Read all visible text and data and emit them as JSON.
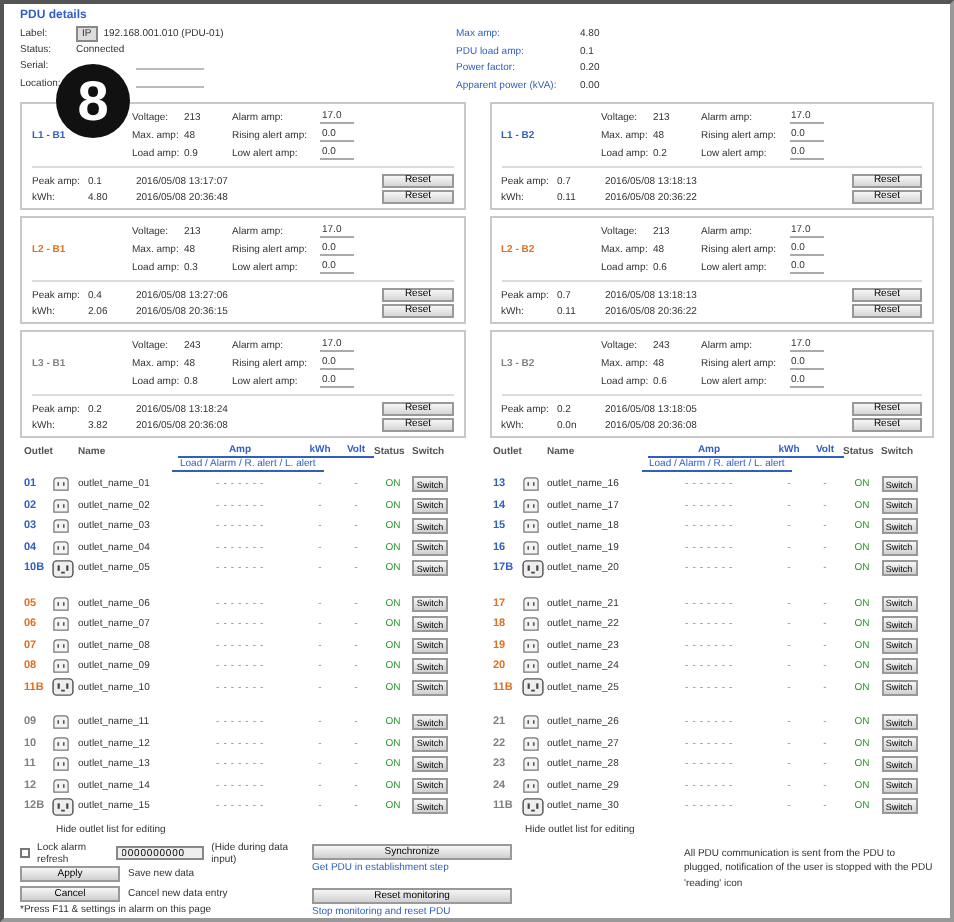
{
  "badge": "8",
  "title": "PDU details",
  "info_left": [
    {
      "label": "Label:",
      "tag": "IP",
      "value": "192.168.001.010 (PDU-01)"
    },
    {
      "label": "Status:",
      "value": "Connected"
    },
    {
      "label": "Serial:"
    },
    {
      "label": "Location:"
    }
  ],
  "info_right": [
    {
      "label": "Max amp:",
      "value": "4.80"
    },
    {
      "label": "PDU load amp:",
      "value": "0.1"
    },
    {
      "label": "Power factor:",
      "value": "0.20"
    },
    {
      "label": "Apparent power (kVA):",
      "value": "0.00"
    }
  ],
  "columns": [
    {
      "phases": [
        {
          "name": "L1 - B1",
          "color": "#2f5fc4",
          "readings": [
            {
              "label": "Voltage:",
              "value": "213"
            },
            {
              "label": "Max. amp:",
              "value": "48"
            },
            {
              "label": "Load amp:",
              "value": "0.9"
            }
          ],
          "alerts": [
            {
              "label": "Alarm amp:",
              "value": "17.0"
            },
            {
              "label": "Rising alert amp:",
              "value": "0.0"
            },
            {
              "label": "Low alert amp:",
              "value": "0.0"
            }
          ],
          "history": [
            {
              "label": "Peak amp:",
              "value": "0.1",
              "time": "2016/05/08 13:17:07",
              "button": "Reset"
            },
            {
              "label": "kWh:",
              "value": "4.80",
              "time": "2016/05/08 20:36:48",
              "button": "Reset"
            }
          ]
        },
        {
          "name": "L2 - B1",
          "color": "#e07020",
          "readings": [
            {
              "label": "Voltage:",
              "value": "213"
            },
            {
              "label": "Max. amp:",
              "value": "48"
            },
            {
              "label": "Load amp:",
              "value": "0.3"
            }
          ],
          "alerts": [
            {
              "label": "Alarm amp:",
              "value": "17.0"
            },
            {
              "label": "Rising alert amp:",
              "value": "0.0"
            },
            {
              "label": "Low alert amp:",
              "value": "0.0"
            }
          ],
          "history": [
            {
              "label": "Peak amp:",
              "value": "0.4",
              "time": "2016/05/08 13:27:06",
              "button": "Reset"
            },
            {
              "label": "kWh:",
              "value": "2.06",
              "time": "2016/05/08 20:36:15",
              "button": "Reset"
            }
          ]
        },
        {
          "name": "L3 - B1",
          "color": "#808080",
          "readings": [
            {
              "label": "Voltage:",
              "value": "243"
            },
            {
              "label": "Max. amp:",
              "value": "48"
            },
            {
              "label": "Load amp:",
              "value": "0.8"
            }
          ],
          "alerts": [
            {
              "label": "Alarm amp:",
              "value": "17.0"
            },
            {
              "label": "Rising alert amp:",
              "value": "0.0"
            },
            {
              "label": "Low alert amp:",
              "value": "0.0"
            }
          ],
          "history": [
            {
              "label": "Peak amp:",
              "value": "0.2",
              "time": "2016/05/08 13:18:24",
              "button": "Reset"
            },
            {
              "label": "kWh:",
              "value": "3.82",
              "time": "2016/05/08 20:36:08",
              "button": "Reset"
            }
          ]
        }
      ],
      "table": {
        "headers": [
          "Outlet",
          "Name",
          "Amp",
          "kWh",
          "Volt",
          "Status",
          "Switch"
        ],
        "subheader": "Load / Alarm / R. alert / L. alert",
        "groups": [
          {
            "color": "#2f5fc4",
            "rows": [
              {
                "number": "01",
                "kind": "socket",
                "name": "outlet_name_01",
                "readings": "- - - - - - -",
                "kwh": "-",
                "volt": "-",
                "status": "ON",
                "button": "Switch"
              },
              {
                "number": "02",
                "kind": "socket",
                "name": "outlet_name_02",
                "readings": "- - - - - - -",
                "kwh": "-",
                "volt": "-",
                "status": "ON",
                "button": "Switch"
              },
              {
                "number": "03",
                "kind": "socket",
                "name": "outlet_name_03",
                "readings": "- - - - - - -",
                "kwh": "-",
                "volt": "-",
                "status": "ON",
                "button": "Switch"
              },
              {
                "number": "04",
                "kind": "socket",
                "name": "outlet_name_04",
                "readings": "- - - - - - -",
                "kwh": "-",
                "volt": "-",
                "status": "ON",
                "button": "Switch"
              },
              {
                "number": "10B",
                "kind": "c19",
                "name": "outlet_name_05",
                "readings": "- - - - - - -",
                "kwh": "-",
                "volt": "-",
                "status": "ON",
                "button": "Switch"
              }
            ]
          },
          {
            "color": "#e07020",
            "rows": [
              {
                "number": "05",
                "kind": "socket",
                "name": "outlet_name_06",
                "readings": "- - - - - - -",
                "kwh": "-",
                "volt": "-",
                "status": "ON",
                "button": "Switch"
              },
              {
                "number": "06",
                "kind": "socket",
                "name": "outlet_name_07",
                "readings": "- - - - - - -",
                "kwh": "-",
                "volt": "-",
                "status": "ON",
                "button": "Switch"
              },
              {
                "number": "07",
                "kind": "socket",
                "name": "outlet_name_08",
                "readings": "- - - - - - -",
                "kwh": "-",
                "volt": "-",
                "status": "ON",
                "button": "Switch"
              },
              {
                "number": "08",
                "kind": "socket",
                "name": "outlet_name_09",
                "readings": "- - - - - - -",
                "kwh": "-",
                "volt": "-",
                "status": "ON",
                "button": "Switch"
              },
              {
                "number": "11B",
                "kind": "c19",
                "name": "outlet_name_10",
                "readings": "- - - - - - -",
                "kwh": "-",
                "volt": "-",
                "status": "ON",
                "button": "Switch"
              }
            ]
          },
          {
            "color": "#808080",
            "rows": [
              {
                "number": "09",
                "kind": "socket",
                "name": "outlet_name_11",
                "readings": "- - - - - - -",
                "kwh": "-",
                "volt": "-",
                "status": "ON",
                "button": "Switch"
              },
              {
                "number": "10",
                "kind": "socket",
                "name": "outlet_name_12",
                "readings": "- - - - - - -",
                "kwh": "-",
                "volt": "-",
                "status": "ON",
                "button": "Switch"
              },
              {
                "number": "11",
                "kind": "socket",
                "name": "outlet_name_13",
                "readings": "- - - - - - -",
                "kwh": "-",
                "volt": "-",
                "status": "ON",
                "button": "Switch"
              },
              {
                "number": "12",
                "kind": "socket",
                "name": "outlet_name_14",
                "readings": "- - - - - - -",
                "kwh": "-",
                "volt": "-",
                "status": "ON",
                "button": "Switch"
              },
              {
                "number": "12B",
                "kind": "c19",
                "name": "outlet_name_15",
                "readings": "- - - - - - -",
                "kwh": "-",
                "volt": "-",
                "status": "ON",
                "button": "Switch"
              }
            ]
          }
        ],
        "footer": "Hide outlet list for editing"
      }
    },
    {
      "phases": [
        {
          "name": "L1 - B2",
          "color": "#2f5fc4",
          "readings": [
            {
              "label": "Voltage:",
              "value": "213"
            },
            {
              "label": "Max. amp:",
              "value": "48"
            },
            {
              "label": "Load amp:",
              "value": "0.2"
            }
          ],
          "alerts": [
            {
              "label": "Alarm amp:",
              "value": "17.0"
            },
            {
              "label": "Rising alert amp:",
              "value": "0.0"
            },
            {
              "label": "Low alert amp:",
              "value": "0.0"
            }
          ],
          "history": [
            {
              "label": "Peak amp:",
              "value": "0.7",
              "time": "2016/05/08 13:18:13",
              "button": "Reset"
            },
            {
              "label": "kWh:",
              "value": "0.11",
              "time": "2016/05/08 20:36:22",
              "button": "Reset"
            }
          ]
        },
        {
          "name": "L2 - B2",
          "color": "#e07020",
          "readings": [
            {
              "label": "Voltage:",
              "value": "213"
            },
            {
              "label": "Max. amp:",
              "value": "48"
            },
            {
              "label": "Load amp:",
              "value": "0.6"
            }
          ],
          "alerts": [
            {
              "label": "Alarm amp:",
              "value": "17.0"
            },
            {
              "label": "Rising alert amp:",
              "value": "0.0"
            },
            {
              "label": "Low alert amp:",
              "value": "0.0"
            }
          ],
          "history": [
            {
              "label": "Peak amp:",
              "value": "0.7",
              "time": "2016/05/08 13:18:13",
              "button": "Reset"
            },
            {
              "label": "kWh:",
              "value": "0.11",
              "time": "2016/05/08 20:36:22",
              "button": "Reset"
            }
          ]
        },
        {
          "name": "L3 - B2",
          "color": "#808080",
          "readings": [
            {
              "label": "Voltage:",
              "value": "243"
            },
            {
              "label": "Max. amp:",
              "value": "48"
            },
            {
              "label": "Load amp:",
              "value": "0.6"
            }
          ],
          "alerts": [
            {
              "label": "Alarm amp:",
              "value": "17.0"
            },
            {
              "label": "Rising alert amp:",
              "value": "0.0"
            },
            {
              "label": "Low alert amp:",
              "value": "0.0"
            }
          ],
          "history": [
            {
              "label": "Peak amp:",
              "value": "0.2",
              "time": "2016/05/08 13:18:05",
              "button": "Reset"
            },
            {
              "label": "kWh:",
              "value": "0.0n",
              "time": "2016/05/08 20:36:08",
              "button": "Reset"
            }
          ]
        }
      ],
      "table": {
        "headers": [
          "Outlet",
          "Name",
          "Amp",
          "kWh",
          "Volt",
          "Status",
          "Switch"
        ],
        "subheader": "Load / Alarm / R. alert / L. alert",
        "groups": [
          {
            "color": "#2f5fc4",
            "rows": [
              {
                "number": "13",
                "kind": "socket",
                "name": "outlet_name_16",
                "readings": "- - - - - - -",
                "kwh": "-",
                "volt": "-",
                "status": "ON",
                "button": "Switch"
              },
              {
                "number": "14",
                "kind": "socket",
                "name": "outlet_name_17",
                "readings": "- - - - - - -",
                "kwh": "-",
                "volt": "-",
                "status": "ON",
                "button": "Switch"
              },
              {
                "number": "15",
                "kind": "socket",
                "name": "outlet_name_18",
                "readings": "- - - - - - -",
                "kwh": "-",
                "volt": "-",
                "status": "ON",
                "button": "Switch"
              },
              {
                "number": "16",
                "kind": "socket",
                "name": "outlet_name_19",
                "readings": "- - - - - - -",
                "kwh": "-",
                "volt": "-",
                "status": "ON",
                "button": "Switch"
              },
              {
                "number": "17B",
                "kind": "c19",
                "name": "outlet_name_20",
                "readings": "- - - - - - -",
                "kwh": "-",
                "volt": "-",
                "status": "ON",
                "button": "Switch"
              }
            ]
          },
          {
            "color": "#e07020",
            "rows": [
              {
                "number": "17",
                "kind": "socket",
                "name": "outlet_name_21",
                "readings": "- - - - - - -",
                "kwh": "-",
                "volt": "-",
                "status": "ON",
                "button": "Switch"
              },
              {
                "number": "18",
                "kind": "socket",
                "name": "outlet_name_22",
                "readings": "- - - - - - -",
                "kwh": "-",
                "volt": "-",
                "status": "ON",
                "button": "Switch"
              },
              {
                "number": "19",
                "kind": "socket",
                "name": "outlet_name_23",
                "readings": "- - - - - - -",
                "kwh": "-",
                "volt": "-",
                "status": "ON",
                "button": "Switch"
              },
              {
                "number": "20",
                "kind": "socket",
                "name": "outlet_name_24",
                "readings": "- - - - - - -",
                "kwh": "-",
                "volt": "-",
                "status": "ON",
                "button": "Switch"
              },
              {
                "number": "11B",
                "kind": "c19",
                "name": "outlet_name_25",
                "readings": "- - - - - - -",
                "kwh": "-",
                "volt": "-",
                "status": "ON",
                "button": "Switch"
              }
            ]
          },
          {
            "color": "#808080",
            "rows": [
              {
                "number": "21",
                "kind": "socket",
                "name": "outlet_name_26",
                "readings": "- - - - - - -",
                "kwh": "-",
                "volt": "-",
                "status": "ON",
                "button": "Switch"
              },
              {
                "number": "22",
                "kind": "socket",
                "name": "outlet_name_27",
                "readings": "- - - - - - -",
                "kwh": "-",
                "volt": "-",
                "status": "ON",
                "button": "Switch"
              },
              {
                "number": "23",
                "kind": "socket",
                "name": "outlet_name_28",
                "readings": "- - - - - - -",
                "kwh": "-",
                "volt": "-",
                "status": "ON",
                "button": "Switch"
              },
              {
                "number": "24",
                "kind": "socket",
                "name": "outlet_name_29",
                "readings": "- - - - - - -",
                "kwh": "-",
                "volt": "-",
                "status": "ON",
                "button": "Switch"
              },
              {
                "number": "11B",
                "kind": "c19",
                "name": "outlet_name_30",
                "readings": "- - - - - - -",
                "kwh": "-",
                "volt": "-",
                "status": "ON",
                "button": "Switch"
              }
            ]
          }
        ],
        "footer": "Hide outlet list for editing"
      }
    }
  ],
  "bottom": {
    "lock": {
      "label": "Lock alarm refresh",
      "checked": false
    },
    "field": "0000000000",
    "field_note": "(Hide during data input)",
    "actions": [
      {
        "button": "Apply",
        "note": "Save new data"
      },
      {
        "button": "Cancel",
        "note": "Cancel new data entry"
      }
    ],
    "footnote": "*Press F11 & settings in alarm on this page",
    "tools": [
      {
        "button": "Synchronize",
        "link": "Get PDU in establishment step"
      },
      {
        "button": "Reset monitoring",
        "link": "Stop monitoring and reset PDU"
      }
    ],
    "message": "All PDU communication is sent from the PDU to plugged, notification of the user is stopped with the PDU 'reading' icon"
  }
}
